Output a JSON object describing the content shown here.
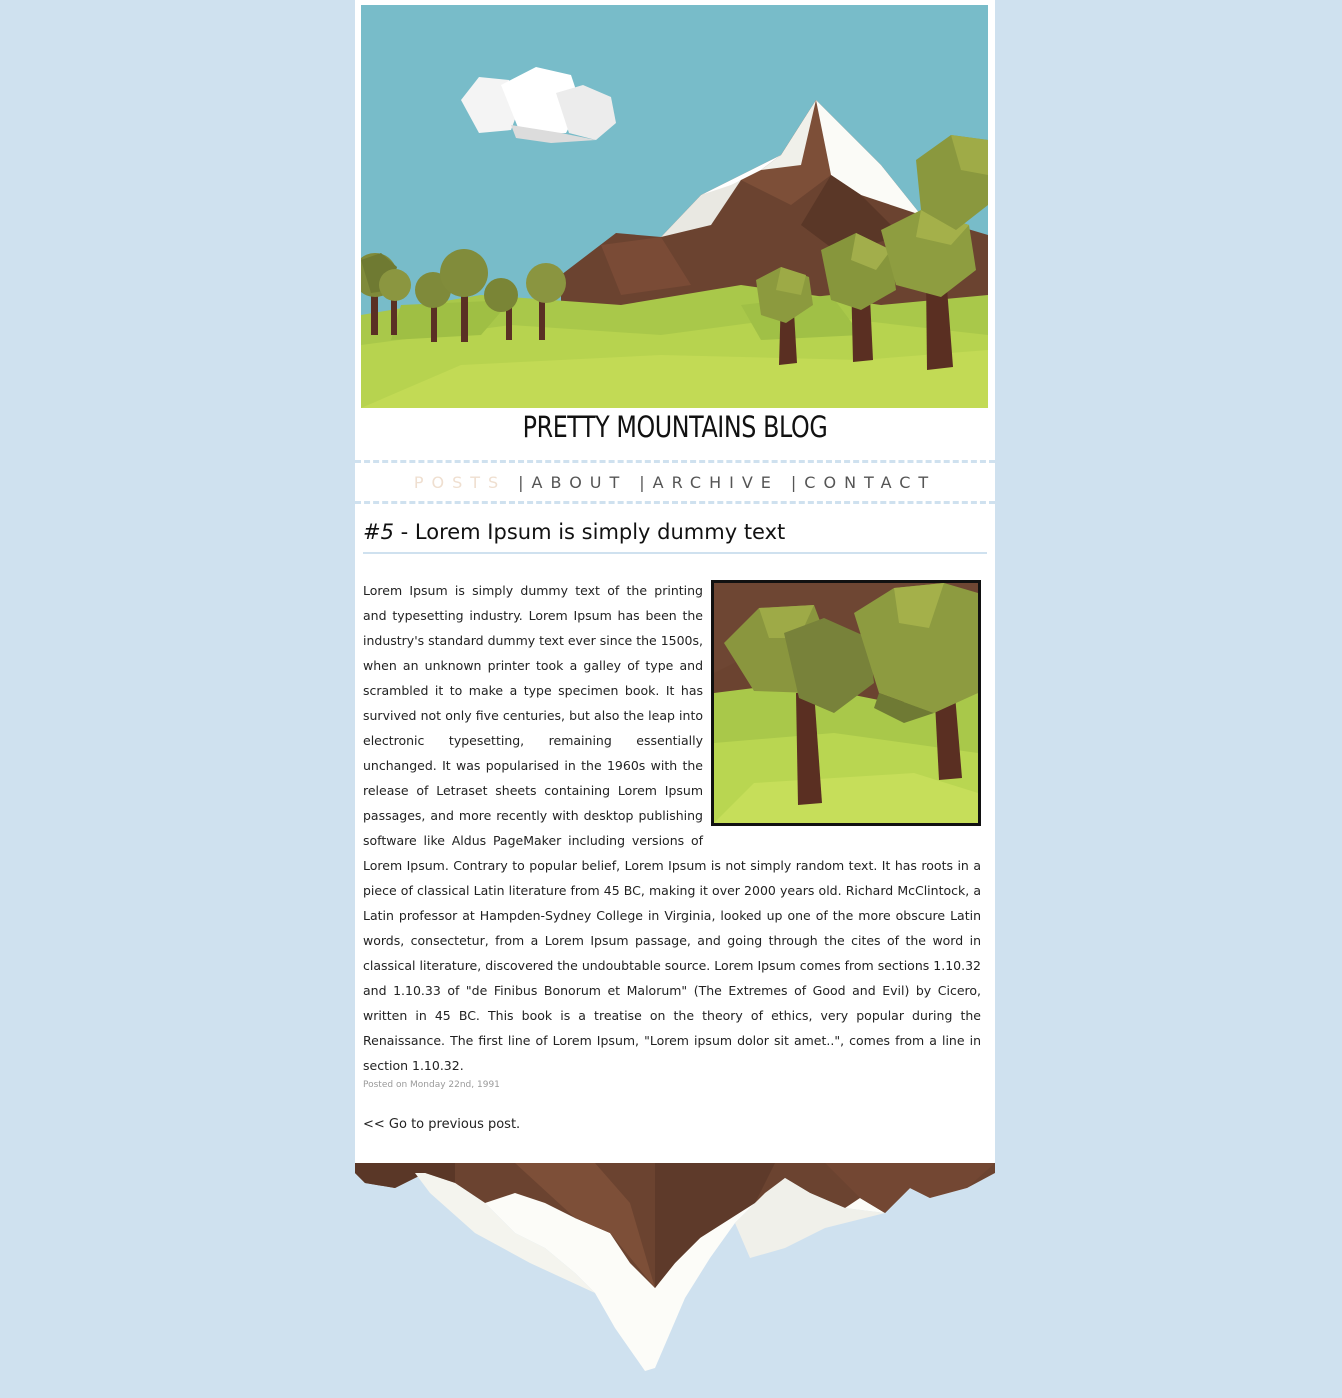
{
  "blog": {
    "title": "PRETTY MOUNTAINS BLOG"
  },
  "nav": {
    "items": [
      {
        "label": "POSTS",
        "active": true
      },
      {
        "label": "ABOUT",
        "active": false
      },
      {
        "label": "ARCHIVE",
        "active": false
      },
      {
        "label": "CONTACT",
        "active": false
      }
    ],
    "separator": "|"
  },
  "post": {
    "number": "#5",
    "dash": " - ",
    "title": "Lorem Ipsum is simply dummy text",
    "body": "Lorem Ipsum is simply dummy text of the printing and typesetting industry. Lorem Ipsum has been the industry's standard dummy text ever since the 1500s, when an unknown printer took a galley of type and scrambled it to make a type specimen book. It has survived not only five centuries, but also the leap into electronic typesetting, remaining essentially unchanged. It was popularised in the 1960s with the release of Letraset sheets containing Lorem Ipsum passages, and more recently with desktop publishing software like Aldus PageMaker including versions of Lorem Ipsum. Contrary to popular belief, Lorem Ipsum is not simply random text. It has roots in a piece of classical Latin literature from 45 BC, making it over 2000 years old. Richard McClintock, a Latin professor at Hampden-Sydney College in Virginia, looked up one of the more obscure Latin words, consectetur, from a Lorem Ipsum passage, and going through the cites of the word in classical literature, discovered the undoubtable source. Lorem Ipsum comes from sections 1.10.32 and 1.10.33 of \"de Finibus Bonorum et Malorum\" (The Extremes of Good and Evil) by Cicero, written in 45 BC. This book is a treatise on the theory of ethics, very popular during the Renaissance. The first line of Lorem Ipsum, \"Lorem ipsum dolor sit amet..\", comes from a line in section 1.10.32.",
    "meta": "Posted on Monday 22nd, 1991",
    "prev_link": "<< Go to previous post."
  },
  "colors": {
    "page_bg": "#cfe1ef",
    "card_bg": "#ffffff",
    "nav_active": "#efdfd0",
    "sky": "#78bcc9",
    "grass": "#a9c84a",
    "mountain_brown": "#6b4330",
    "snow": "#fbfbf7"
  }
}
